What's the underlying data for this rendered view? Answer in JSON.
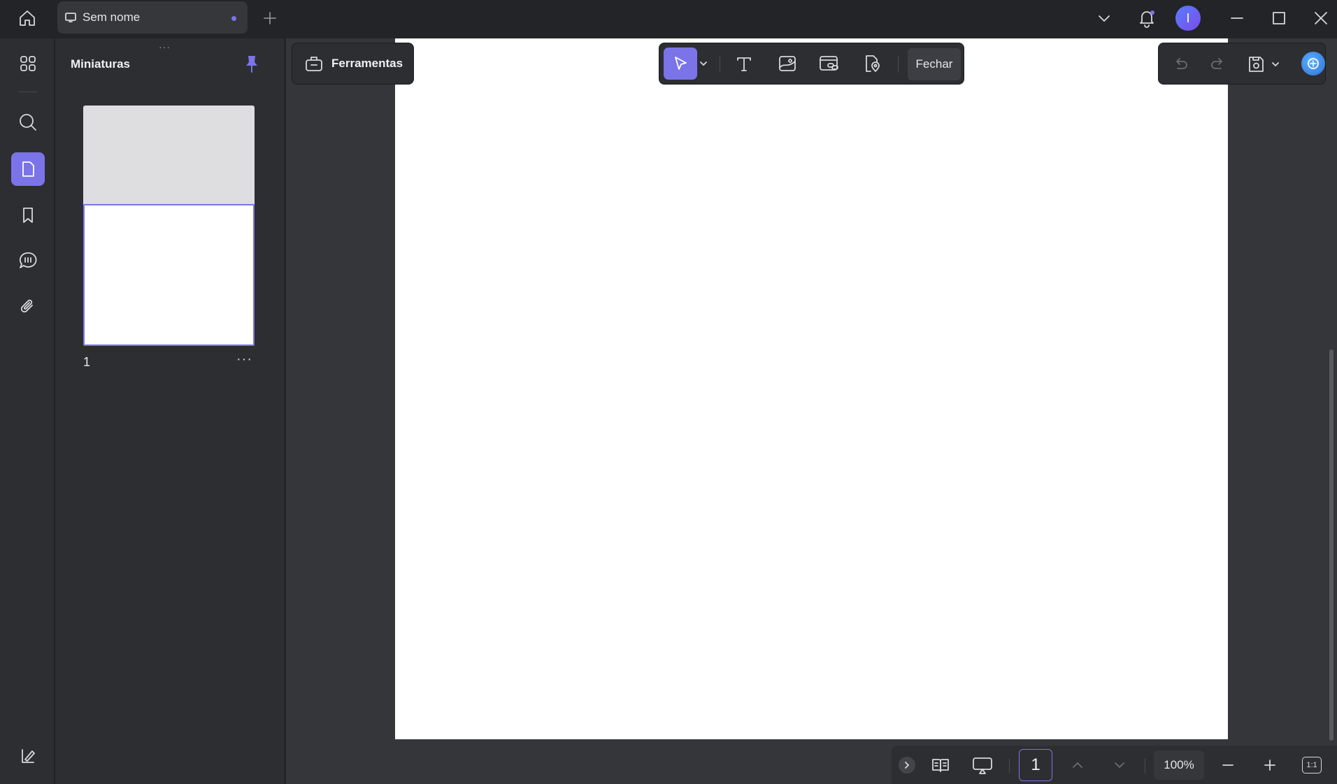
{
  "titlebar": {
    "tab_title": "Sem nome",
    "avatar_initial": "I",
    "icons": [
      "home-icon",
      "monitor-icon",
      "plus-icon",
      "chevron-down-icon",
      "bell-icon",
      "minimize-icon",
      "maximize-icon",
      "close-icon"
    ]
  },
  "left_rail": {
    "items": [
      {
        "name": "grid-icon",
        "active": false
      },
      {
        "name": "search-icon",
        "active": false
      },
      {
        "name": "page-icon",
        "active": true
      },
      {
        "name": "bookmark-icon",
        "active": false
      },
      {
        "name": "comment-icon",
        "active": false
      },
      {
        "name": "paperclip-icon",
        "active": false
      }
    ],
    "bottom_icon": "sidebar-toggle-icon"
  },
  "thumbnails": {
    "title": "Miniaturas",
    "pages": [
      {
        "number": "1"
      }
    ],
    "more_label": "···",
    "grip": "···"
  },
  "toolbar": {
    "tools_label": "Ferramentas",
    "close_label": "Fechar",
    "edit_tools": [
      "select-arrow-icon",
      "text-icon",
      "image-icon",
      "link-icon",
      "location-icon"
    ]
  },
  "bottom_bar": {
    "page_number": "1",
    "zoom": "100%",
    "fit_label": "1:1"
  },
  "colors": {
    "accent": "#7b74e8",
    "background": "#232427",
    "panel": "#2d2e32",
    "canvas_area": "#353639"
  }
}
